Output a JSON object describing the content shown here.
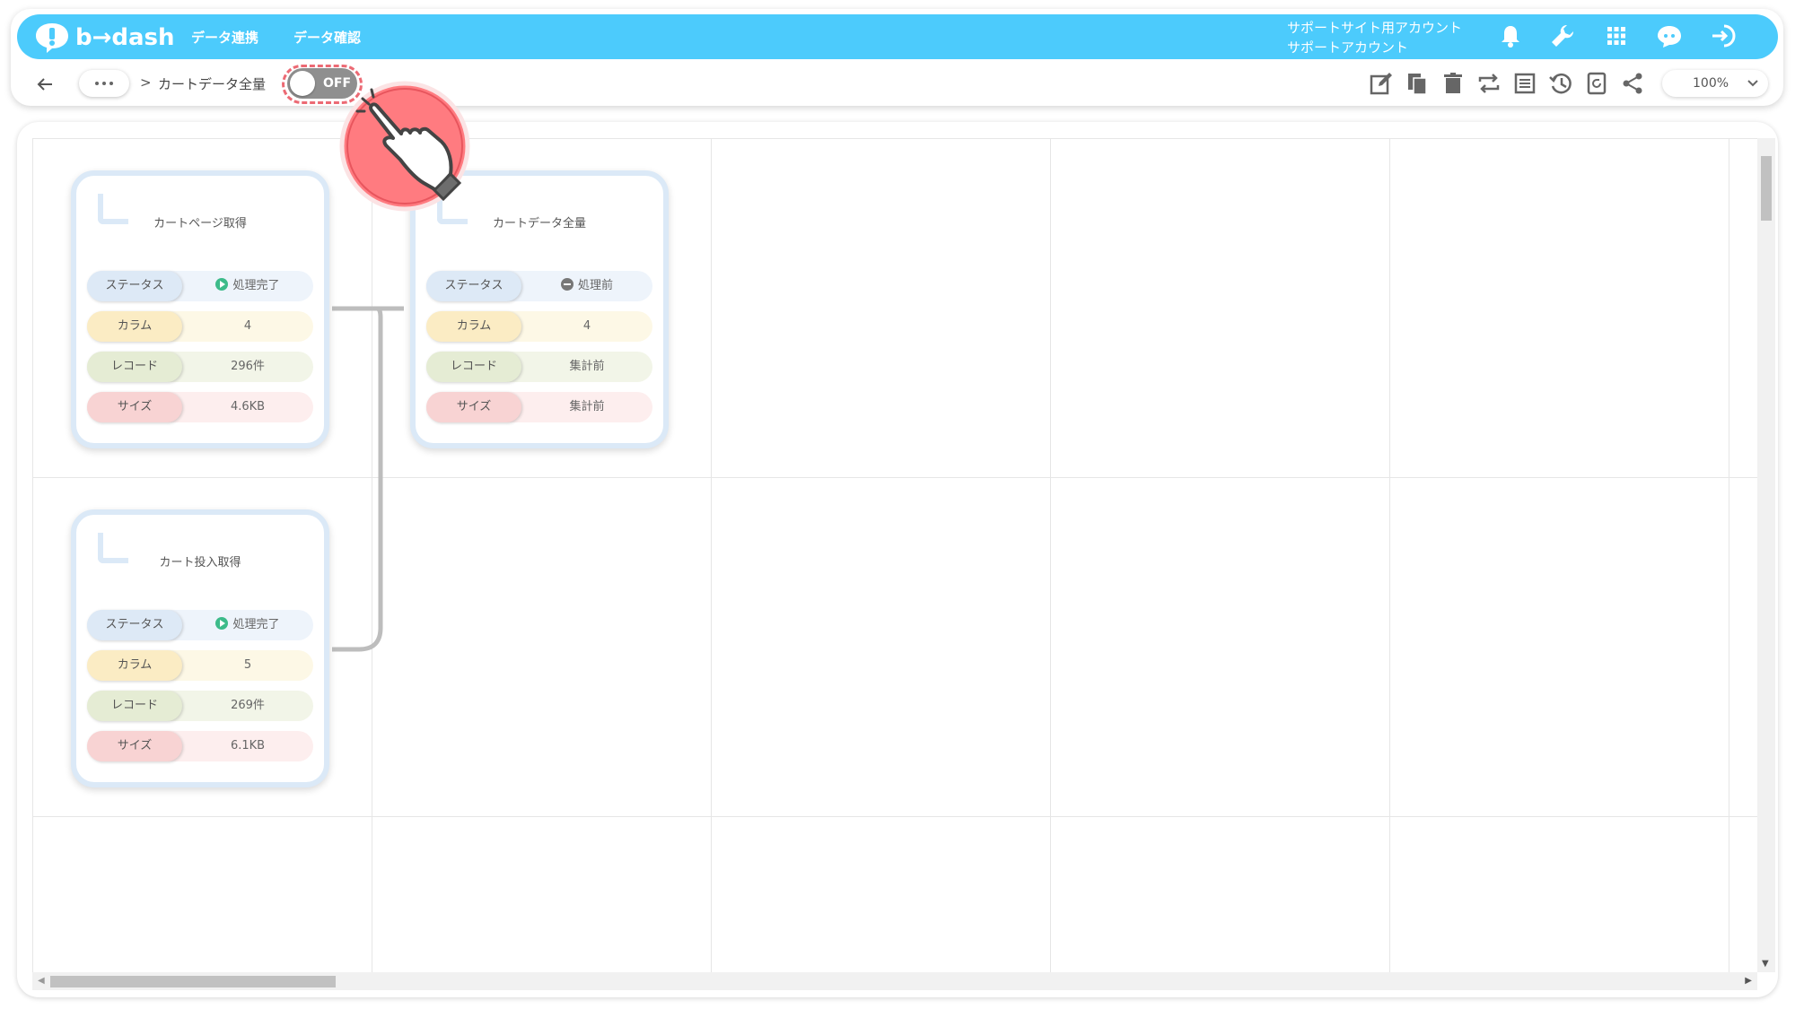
{
  "app": {
    "brand": "b→dash"
  },
  "header": {
    "nav": [
      "データ連携",
      "データ確認"
    ],
    "account_line1": "サポートサイト用アカウント",
    "account_line2": "サポートアカウント",
    "icons": [
      "bell-icon",
      "wrench-icon",
      "grid-icon",
      "chat-bot-icon",
      "logout-icon"
    ]
  },
  "toolbar": {
    "more": "…",
    "breadcrumb_sep": ">",
    "breadcrumb_title": "カートデータ全量",
    "toggle_label": "OFF",
    "toggle_state": false,
    "tools": [
      "edit-icon",
      "copy-icon",
      "delete-icon",
      "swap-icon",
      "list-icon",
      "history-icon",
      "refresh-icon",
      "share-icon"
    ],
    "zoom": "100%"
  },
  "cards": [
    {
      "title": "カートページ取得",
      "rows": [
        {
          "label": "ステータス",
          "value": "処理完了",
          "status": "done"
        },
        {
          "label": "カラム",
          "value": "4"
        },
        {
          "label": "レコード",
          "value": "296件"
        },
        {
          "label": "サイズ",
          "value": "4.6KB"
        }
      ]
    },
    {
      "title": "カートデータ全量",
      "rows": [
        {
          "label": "ステータス",
          "value": "処理前",
          "status": "pending"
        },
        {
          "label": "カラム",
          "value": "4"
        },
        {
          "label": "レコード",
          "value": "集計前"
        },
        {
          "label": "サイズ",
          "value": "集計前"
        }
      ]
    },
    {
      "title": "カート投入取得",
      "rows": [
        {
          "label": "ステータス",
          "value": "処理完了",
          "status": "done"
        },
        {
          "label": "カラム",
          "value": "5"
        },
        {
          "label": "レコード",
          "value": "269件"
        },
        {
          "label": "サイズ",
          "value": "6.1KB"
        }
      ]
    }
  ],
  "colors": {
    "header_bg": "#4ccbfc",
    "toggle_off": "#8f8f8f",
    "highlight": "#ec6a74",
    "status_done": "#3dbb8a"
  }
}
